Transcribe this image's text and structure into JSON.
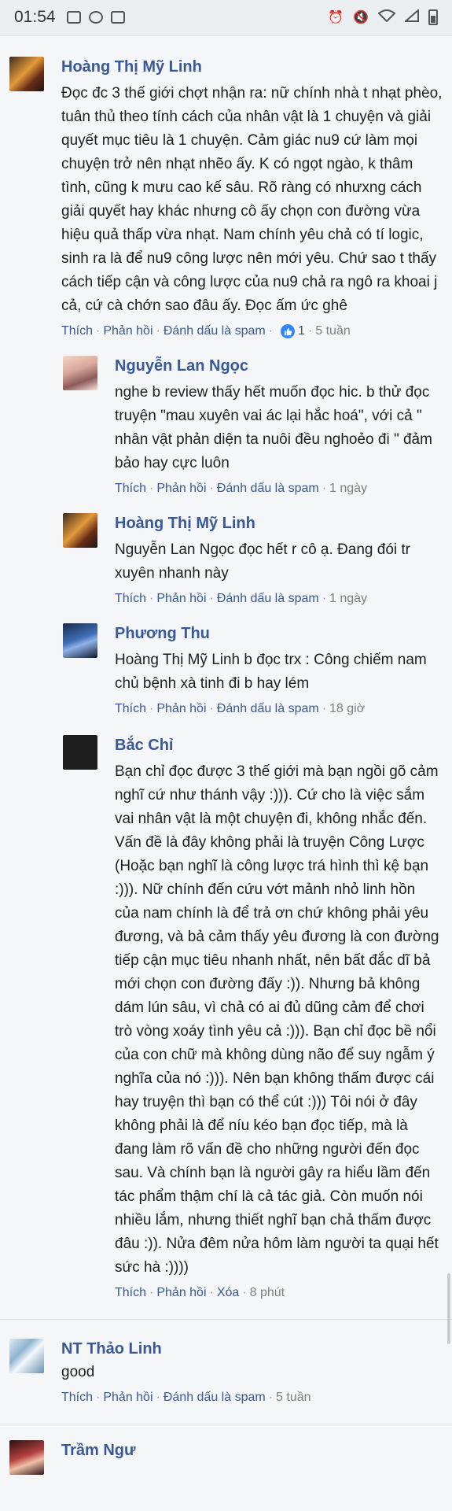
{
  "status_bar": {
    "time": "01:54"
  },
  "comments": [
    {
      "author": "Hoàng Thị Mỹ Linh",
      "text": "Đọc đc 3 thế giới chợt nhận ra: nữ chính nhà t nhạt phèo, tuân thủ theo tính cách của nhân vật là 1 chuyện và giải quyết mục tiêu là 1 chuyện. Cảm giác nu9 cứ làm mọi chuyện trở nên nhạt nhẽo ấy. K có ngọt ngào, k thâm tình, cũng k mưu cao kế sâu. Rõ ràng có nhưxng cách giải quyết hay khác nhưng cô ấy chọn con đường vừa hiệu quả thấp vừa nhạt. Nam chính yêu chả có tí logic, sinh ra là để nu9 công lược nên mới yêu. Chứ sao t thấy cách tiếp cận và công lược của nu9 chả ra ngô ra khoai j cả, cứ cà chớn sao đâu ấy. Đọc ấm ức ghê",
      "like": "Thích",
      "reply": "Phản hồi",
      "spam": "Đánh dấu là spam",
      "reactions": "1",
      "time": "5 tuần",
      "replies": [
        {
          "author": "Nguyễn Lan Ngọc",
          "text": "nghe b review thấy hết muốn đọc hic. b thử đọc truyện \"mau xuyên vai ác lại hắc hoá\", với cả \" nhân vật phản diện ta nuôi đều nghoẻo đi \" đảm bảo hay cực luôn",
          "like": "Thích",
          "reply": "Phản hồi",
          "spam": "Đánh dấu là spam",
          "time": "1 ngày"
        },
        {
          "author": "Hoàng Thị Mỹ Linh",
          "text": "Nguyễn Lan Ngọc đọc hết r cô ạ. Đang đói tr xuyên nhanh này",
          "like": "Thích",
          "reply": "Phản hồi",
          "spam": "Đánh dấu là spam",
          "time": "1 ngày"
        },
        {
          "author": "Phương Thu",
          "text": "Hoàng Thị Mỹ Linh b đọc trx : Công chiếm nam chủ bệnh xà tinh đi b hay lém",
          "like": "Thích",
          "reply": "Phản hồi",
          "spam": "Đánh dấu là spam",
          "time": "18 giờ"
        },
        {
          "author": "Bắc Chỉ",
          "text": "Bạn chỉ đọc được 3 thế giới mà bạn ngồi gõ cảm nghĩ cứ như thánh vậy :))). Cứ cho là việc sắm vai nhân vật là một chuyện đi, không nhắc đến. Vấn đề là đây không phải là truyện Công Lược (Hoặc bạn nghĩ là công lược trá hình thì kệ bạn :))). Nữ chính đến cứu vớt mảnh nhỏ linh hồn của nam chính là để trả ơn chứ không phải yêu đương, và bả cảm thấy yêu đương là con đường tiếp cận mục tiêu nhanh nhất, nên bất đắc dĩ bả mới chọn con đường đấy :)). Nhưng bả không dám lún sâu, vì chả có ai đủ dũng cảm để chơi trò vòng xoáy tình yêu cả :))). Bạn chỉ đọc bề nổi của con chữ mà không dùng não để suy ngẫm ý nghĩa của nó :))). Nên bạn không thấm được cái hay truyện thì bạn có thể cút :))) Tôi nói ở đây không phải là để níu kéo bạn đọc tiếp, mà là đang làm rõ vấn đề cho những người đến đọc sau. Và chính bạn là người gây ra hiểu lầm đến tác phẩm thậm chí là cả tác giả. Còn muốn nói nhiều lắm, nhưng thiết nghĩ bạn chả thấm được đâu :)). Nửa đêm nửa hôm làm người ta quại hết sức hà :))))",
          "like": "Thích",
          "reply": "Phản hồi",
          "delete": "Xóa",
          "time": "8 phút"
        }
      ]
    },
    {
      "author": "NT Thảo Linh",
      "text": "good",
      "like": "Thích",
      "reply": "Phản hồi",
      "spam": "Đánh dấu là spam",
      "time": "5 tuần"
    },
    {
      "author": "Trầm Ngư",
      "text": ""
    }
  ],
  "colors": {
    "name": "#385898",
    "link_gray": "#4b4f56",
    "meta": "#90949c",
    "like_badge": "#2d88ff"
  },
  "icons": [
    "image-icon",
    "dnd-icon",
    "checkbox-icon",
    "alarm-icon",
    "mute-icon",
    "wifi-icon",
    "signal-icon",
    "battery-icon",
    "like-badge-icon"
  ]
}
